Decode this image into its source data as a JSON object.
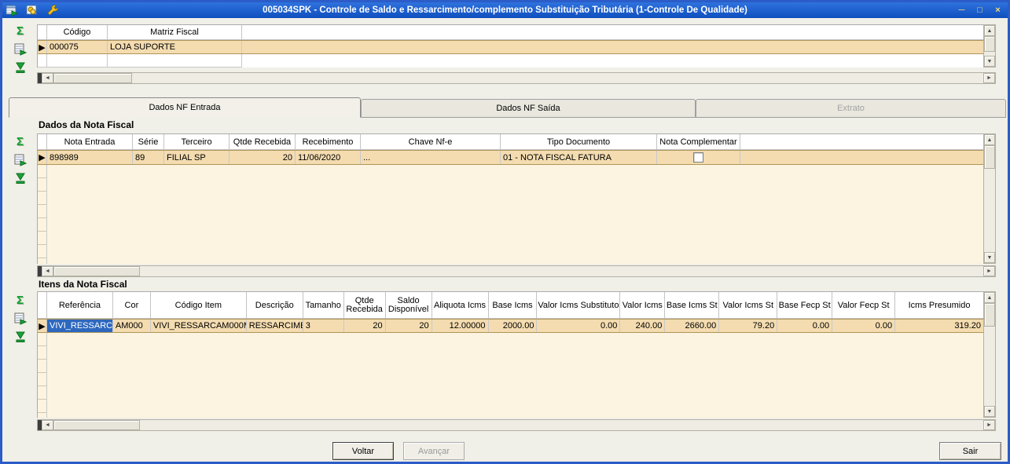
{
  "titlebar": {
    "title": "005034SPK - Controle de Saldo e Ressarcimento/complemento Substituição Tributária (1-Controle De Qualidade)"
  },
  "icons": {
    "sigma": "Σ",
    "marker": "▶",
    "minimize": "─",
    "maximize": "□",
    "close": "×",
    "arrow_left": "◄",
    "arrow_right": "►",
    "arrow_up": "▲",
    "arrow_down": "▼"
  },
  "top_grid": {
    "headers": {
      "codigo": "Código",
      "matriz_fiscal": "Matriz Fiscal"
    },
    "row": {
      "codigo": "000075",
      "matriz_fiscal": "LOJA SUPORTE"
    }
  },
  "tabs": {
    "entrada": "Dados NF Entrada",
    "saida": "Dados NF Saída",
    "extrato": "Extrato"
  },
  "nf": {
    "section_title": "Dados da Nota Fiscal",
    "headers": {
      "nota_entrada": "Nota Entrada",
      "serie": "Série",
      "terceiro": "Terceiro",
      "qtde_recebida": "Qtde Recebida",
      "recebimento": "Recebimento",
      "chave": "Chave Nf-e",
      "tipo_documento": "Tipo Documento",
      "nota_complementar": "Nota Complementar"
    },
    "row": {
      "nota_entrada": "898989",
      "serie": "89",
      "terceiro": "FILIAL SP",
      "qtde_recebida": "20",
      "recebimento": "11/06/2020",
      "chave": "...",
      "tipo_documento": "01  - NOTA FISCAL FATURA",
      "nota_complementar_checked": false
    }
  },
  "itens": {
    "section_title": "Itens da Nota Fiscal",
    "headers": {
      "referencia": "Referência",
      "cor": "Cor",
      "codigo_item": "Código Item",
      "descricao": "Descrição",
      "tamanho": "Tamanho",
      "qtde_recebida": "Qtde Recebida",
      "saldo_disponivel": "Saldo Disponível",
      "aliquota_icms": "Aliquota Icms",
      "base_icms": "Base Icms",
      "valor_icms_substituto": "Valor Icms Substituto",
      "valor_icms": "Valor Icms",
      "base_icms_st": "Base Icms St",
      "valor_icms_st": "Valor Icms St",
      "base_fecp_st": "Base Fecp St",
      "valor_fecp_st": "Valor Fecp St",
      "icms_presumido": "Icms Presumido"
    },
    "row": {
      "referencia": "VIVI_RESSARC",
      "cor": "AM000",
      "codigo_item": "VIVI_RESSARCAM000M",
      "descricao": "RESSARCIME",
      "tamanho": "3",
      "qtde_recebida": "20",
      "saldo_disponivel": "20",
      "aliquota_icms": "12.00000",
      "base_icms": "2000.00",
      "valor_icms_substituto": "0.00",
      "valor_icms": "240.00",
      "base_icms_st": "2660.00",
      "valor_icms_st": "79.20",
      "base_fecp_st": "0.00",
      "valor_fecp_st": "0.00",
      "icms_presumido": "319.20"
    }
  },
  "buttons": {
    "voltar": "Voltar",
    "avancar": "Avançar",
    "sair": "Sair"
  },
  "colors": {
    "titlebar_blue": "#1558C8",
    "row_selected_tan": "#F4DCB0",
    "grid_body_cream": "#FCF4E0",
    "cell_selected_blue": "#2D68BE",
    "icon_green": "#11A12E"
  }
}
